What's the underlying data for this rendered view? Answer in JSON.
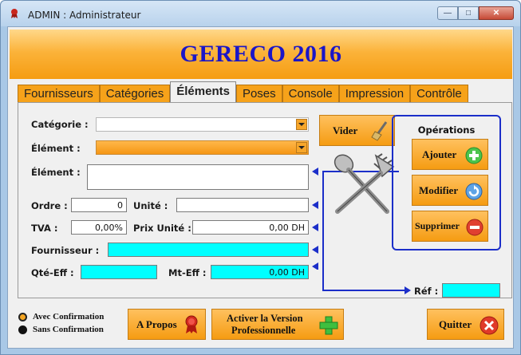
{
  "window": {
    "title": "ADMIN : Administrateur"
  },
  "banner": {
    "title": "GERECO 2016"
  },
  "tabs": [
    {
      "label": "Fournisseurs",
      "active": false
    },
    {
      "label": "Catégories",
      "active": false
    },
    {
      "label": "Éléments",
      "active": true
    },
    {
      "label": "Poses",
      "active": false
    },
    {
      "label": "Console",
      "active": false
    },
    {
      "label": "Impression",
      "active": false
    },
    {
      "label": "Contrôle",
      "active": false
    }
  ],
  "form": {
    "categorie_label": "Catégorie :",
    "categorie_value": "",
    "element_select_label": "Élément :",
    "element_select_value": "",
    "element_text_label": "Élément :",
    "element_text_value": "",
    "ordre_label": "Ordre :",
    "ordre_value": "0",
    "unite_label": "Unité :",
    "unite_value": "",
    "tva_label": "TVA :",
    "tva_value": "0,00%",
    "prix_label": "Prix Unité :",
    "prix_value": "0,00 DH",
    "fournisseur_label": "Fournisseur :",
    "fournisseur_value": "",
    "qte_label": "Qté-Eff :",
    "qte_value": "",
    "mt_label": "Mt-Eff :",
    "mt_value": "0,00 DH",
    "ref_label": "Réf :",
    "ref_value": ""
  },
  "buttons": {
    "vider": "Vider",
    "operations_title": "Opérations",
    "ajouter": "Ajouter",
    "modifier": "Modifier",
    "supprimer": "Supprimer",
    "apropos": "A Propos",
    "activer_line1": "Activer la Version",
    "activer_line2": "Professionnelle",
    "quitter": "Quitter"
  },
  "options": {
    "avec": "Avec Confirmation",
    "sans": "Sans Confirmation",
    "selected": "avec"
  },
  "colors": {
    "accent_orange": "#f59c12",
    "banner_text": "#1a16c8",
    "cyan_field": "#00ffff",
    "ops_border": "#1b2ec9"
  }
}
